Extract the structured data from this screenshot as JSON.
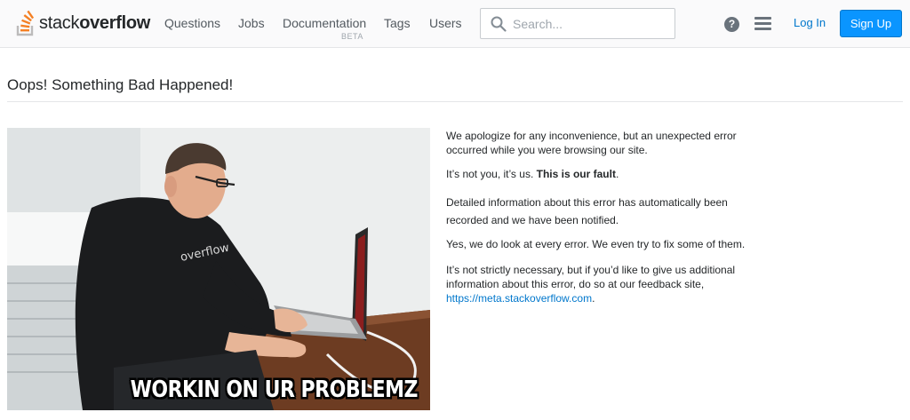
{
  "header": {
    "logo_text_light": "stack",
    "logo_text_bold": "overflow",
    "nav": [
      {
        "label": "Questions"
      },
      {
        "label": "Jobs"
      },
      {
        "label": "Documentation",
        "badge": "BETA"
      },
      {
        "label": "Tags"
      },
      {
        "label": "Users"
      }
    ],
    "search_placeholder": "Search...",
    "login_label": "Log In",
    "signup_label": "Sign Up",
    "help_glyph": "?"
  },
  "page": {
    "title": "Oops! Something Bad Happened!",
    "image_caption": "WORKIN ON UR PROBLEMZ",
    "shirt_text": "overflow",
    "paragraphs": [
      "We apologize for any inconvenience, but an unexpected error occurred while you were browsing our site.",
      "It’s not you, it’s us.",
      "This is our fault",
      ".",
      "Detailed information about this error has automatically been recorded and we have been notified.",
      "Yes, we do look at every error. We even try to fix some of them.",
      "It’s not strictly necessary, but if you’d like to give us additional information about this error, do so at our feedback site,",
      "https://meta.stackoverflow.com",
      "."
    ]
  },
  "colors": {
    "accent": "#0a95ff",
    "link": "#0077cc",
    "logo_orange": "#f48024"
  }
}
